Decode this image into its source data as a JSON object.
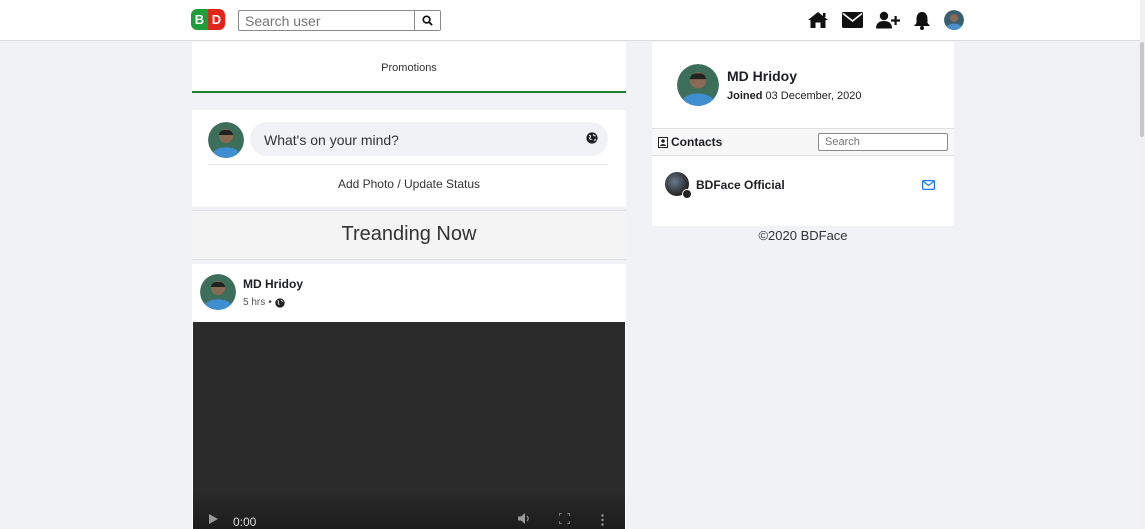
{
  "header": {
    "logo": {
      "letter1": "B",
      "letter2": "D"
    },
    "search": {
      "placeholder": "Search user"
    },
    "icons": [
      "home-icon",
      "envelope-icon",
      "user-plus-icon",
      "bell-icon",
      "profile-avatar"
    ]
  },
  "promotions": {
    "label": "Promotions"
  },
  "composer": {
    "prompt": "What's on your mind?",
    "action": "Add Photo / Update Status"
  },
  "trending": {
    "title": "Treanding Now"
  },
  "post": {
    "author": "MD Hridoy",
    "time": "5 hrs",
    "separator": "•",
    "video": {
      "time": "0:00"
    }
  },
  "profile": {
    "name": "MD Hridoy",
    "joined_label": "Joined",
    "joined_date": "03 December, 2020"
  },
  "contacts": {
    "title": "Contacts",
    "search_placeholder": "Search",
    "items": [
      {
        "name": "BDFace Official"
      }
    ]
  },
  "footer": {
    "text": "©2020 BDFace"
  },
  "colors": {
    "accent_green": "#1e7e34",
    "logo_green": "#1e9e3a",
    "logo_red": "#e2231a",
    "mail_blue": "#1877f2"
  }
}
